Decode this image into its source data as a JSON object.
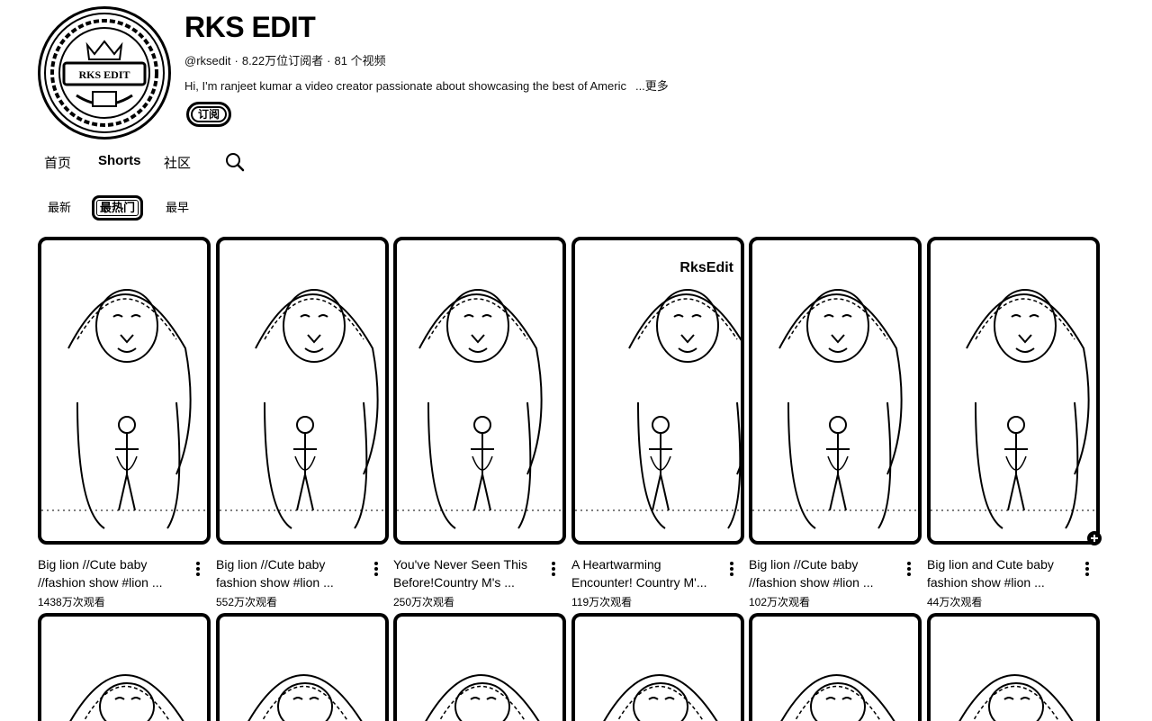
{
  "channel": {
    "name": "RKS EDIT",
    "handle": "@rksedit",
    "subscribers": "8.22万位订阅者",
    "videos": "81 个视频",
    "description": "Hi, I'm ranjeet kumar a video creator passionate about showcasing the best of Americ",
    "more_label": "...更多",
    "subscribe_label": "订阅",
    "avatar_text": "RKS EDIT"
  },
  "tabs": [
    {
      "label": "首页"
    },
    {
      "label": "Shorts"
    },
    {
      "label": "社区"
    }
  ],
  "filters": [
    {
      "label": "最新"
    },
    {
      "label": "最热门"
    },
    {
      "label": "最早"
    }
  ],
  "shorts": [
    {
      "title": "Big lion //Cute baby //fashion show  #lion ...",
      "views": "1438万次观看"
    },
    {
      "title": "Big lion //Cute baby fashion show  #lion ...",
      "views": "552万次观看"
    },
    {
      "title": "You've Never Seen This Before!Country M's ...",
      "views": "250万次观看"
    },
    {
      "title": "A Heartwarming Encounter! Country M'...",
      "views": "119万次观看",
      "watermark": "RksEdit"
    },
    {
      "title": "Big lion //Cute baby //fashion show  #lion ...",
      "views": "102万次观看"
    },
    {
      "title": "Big lion and Cute baby fashion show #lion ...",
      "views": "44万次观看"
    }
  ],
  "icons": {
    "search": "search-icon",
    "more": "more-vert-icon",
    "add": "add-circle-icon"
  },
  "colors": {
    "text": "#000000",
    "background": "#ffffff"
  }
}
